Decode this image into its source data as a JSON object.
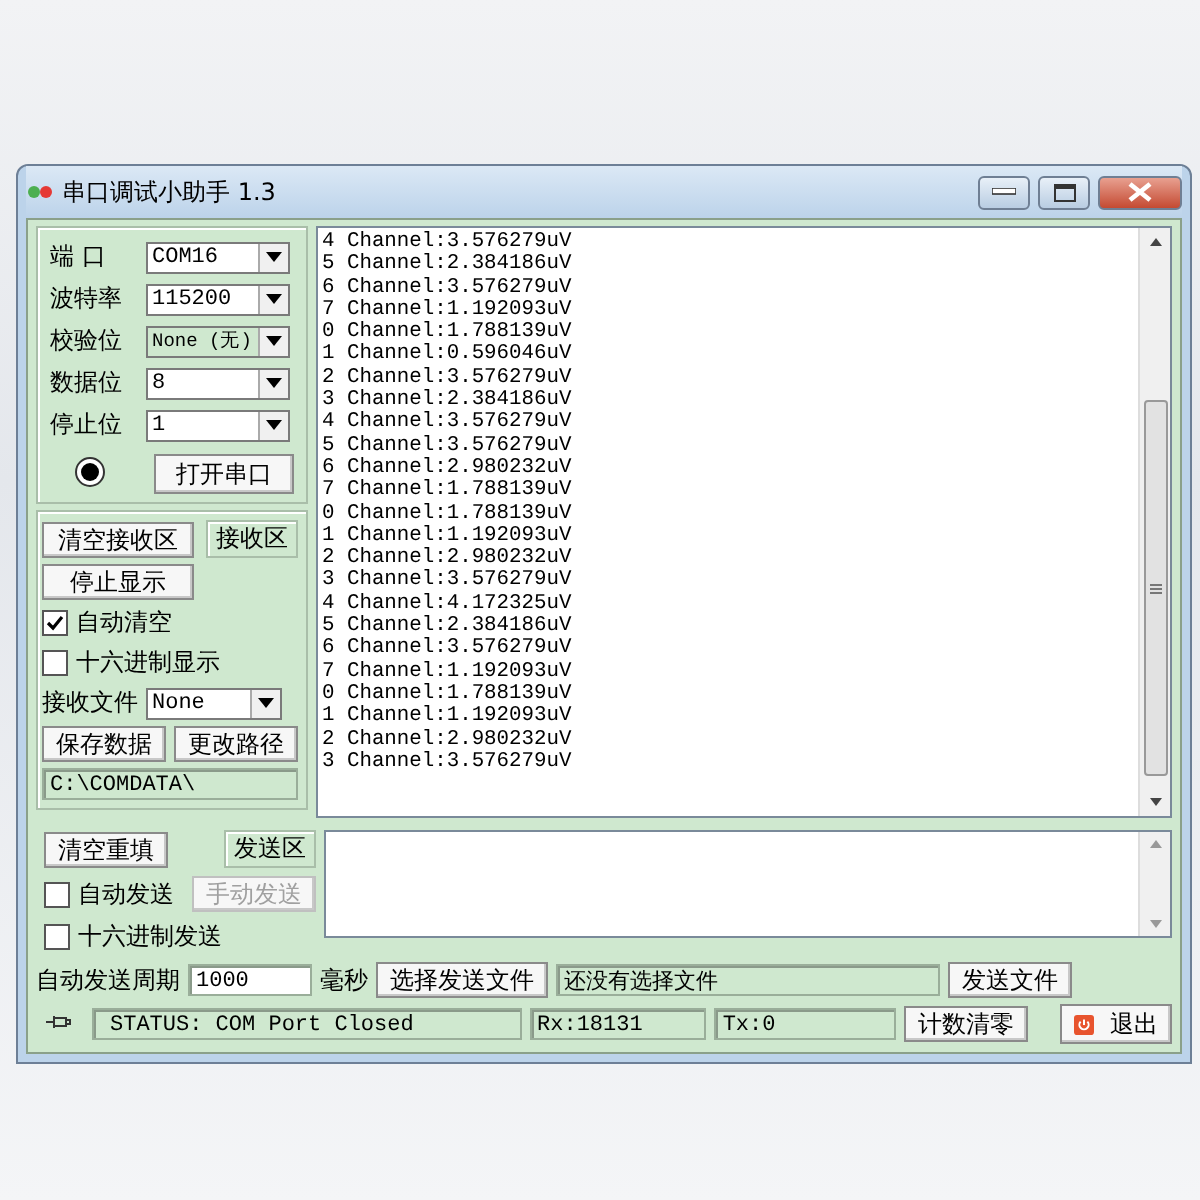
{
  "window": {
    "title": "串口调试小助手 1.3"
  },
  "settings": [
    {
      "label": "端 口",
      "value": "COM16"
    },
    {
      "label": "波特率",
      "value": "115200"
    },
    {
      "label": "校验位",
      "value": "None (无)"
    },
    {
      "label": "数据位",
      "value": "8"
    },
    {
      "label": "停止位",
      "value": "1"
    }
  ],
  "port_indicator": {
    "on": false
  },
  "open_port_button": "打开串口",
  "receive": {
    "clear_button": "清空接收区",
    "area_label": "接收区",
    "stop_button": "停止显示",
    "auto_clear": {
      "label": "自动清空",
      "checked": true
    },
    "hex_display": {
      "label": "十六进制显示",
      "checked": false
    },
    "file_label": "接收文件",
    "file_value": "None",
    "save_button": "保存数据",
    "change_path_button": "更改路径",
    "path": "C:\\COMDATA\\",
    "lines": [
      "4 Channel:3.576279uV",
      "5 Channel:2.384186uV",
      "6 Channel:3.576279uV",
      "7 Channel:1.192093uV",
      "0 Channel:1.788139uV",
      "1 Channel:0.596046uV",
      "2 Channel:3.576279uV",
      "3 Channel:2.384186uV",
      "4 Channel:3.576279uV",
      "5 Channel:3.576279uV",
      "6 Channel:2.980232uV",
      "7 Channel:1.788139uV",
      "0 Channel:1.788139uV",
      "1 Channel:1.192093uV",
      "2 Channel:2.980232uV",
      "3 Channel:3.576279uV",
      "4 Channel:4.172325uV",
      "5 Channel:2.384186uV",
      "6 Channel:3.576279uV",
      "7 Channel:1.192093uV",
      "0 Channel:1.788139uV",
      "1 Channel:1.192093uV",
      "2 Channel:2.980232uV",
      "3 Channel:3.576279uV"
    ]
  },
  "send": {
    "clear_button": "清空重填",
    "area_label": "发送区",
    "auto_send": {
      "label": "自动发送",
      "checked": false
    },
    "manual_send": {
      "label": "手动发送",
      "disabled": true
    },
    "hex_send": {
      "label": "十六进制发送",
      "checked": false
    },
    "period_label": "自动发送周期",
    "period_value": "1000",
    "unit": "毫秒",
    "choose_file_button": "选择发送文件",
    "file_status": "还没有选择文件",
    "send_file_button": "发送文件"
  },
  "status_bar": {
    "status": "STATUS: COM Port Closed",
    "rx": "Rx:18131",
    "tx": "Tx:0",
    "reset_button": "计数清零",
    "exit_button": "退出"
  }
}
